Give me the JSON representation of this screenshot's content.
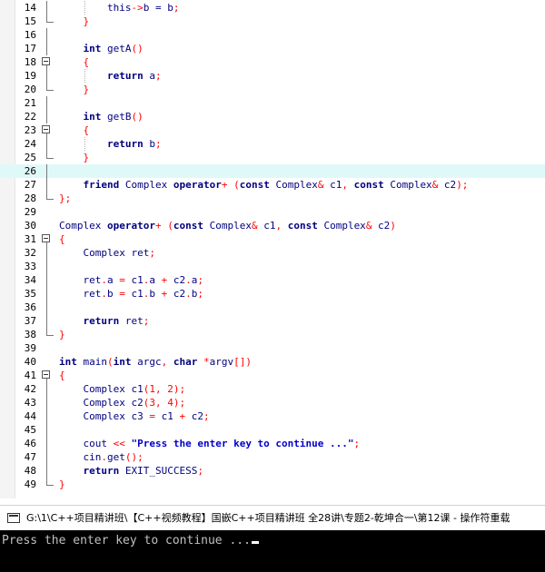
{
  "editor": {
    "lines": [
      {
        "n": "14",
        "parts": [
          [
            "        ",
            ""
          ],
          [
            "this",
            ""
          ],
          [
            "->",
            "op"
          ],
          [
            "b = b",
            ""
          ],
          [
            ";",
            "op"
          ]
        ]
      },
      {
        "n": "15",
        "parts": [
          [
            "    ",
            ""
          ],
          [
            "}",
            "op"
          ]
        ]
      },
      {
        "n": "16",
        "parts": []
      },
      {
        "n": "17",
        "parts": [
          [
            "    ",
            ""
          ],
          [
            "int",
            "kw"
          ],
          [
            " getA",
            ""
          ],
          [
            "()",
            "op"
          ]
        ]
      },
      {
        "n": "18",
        "parts": [
          [
            "    ",
            ""
          ],
          [
            "{",
            "op"
          ]
        ]
      },
      {
        "n": "19",
        "parts": [
          [
            "        ",
            ""
          ],
          [
            "return",
            "kw"
          ],
          [
            " a",
            ""
          ],
          [
            ";",
            "op"
          ]
        ]
      },
      {
        "n": "20",
        "parts": [
          [
            "    ",
            ""
          ],
          [
            "}",
            "op"
          ]
        ]
      },
      {
        "n": "21",
        "parts": []
      },
      {
        "n": "22",
        "parts": [
          [
            "    ",
            ""
          ],
          [
            "int",
            "kw"
          ],
          [
            " getB",
            ""
          ],
          [
            "()",
            "op"
          ]
        ]
      },
      {
        "n": "23",
        "parts": [
          [
            "    ",
            ""
          ],
          [
            "{",
            "op"
          ]
        ]
      },
      {
        "n": "24",
        "parts": [
          [
            "        ",
            ""
          ],
          [
            "return",
            "kw"
          ],
          [
            " b",
            ""
          ],
          [
            ";",
            "op"
          ]
        ]
      },
      {
        "n": "25",
        "parts": [
          [
            "    ",
            ""
          ],
          [
            "}",
            "op"
          ]
        ]
      },
      {
        "n": "26",
        "parts": []
      },
      {
        "n": "27",
        "parts": [
          [
            "    ",
            ""
          ],
          [
            "friend",
            "kw"
          ],
          [
            " Complex ",
            ""
          ],
          [
            "operator",
            "kw"
          ],
          [
            "+",
            "op"
          ],
          [
            " ",
            ""
          ],
          [
            "(",
            "op"
          ],
          [
            "const",
            "kw"
          ],
          [
            " Complex",
            ""
          ],
          [
            "&",
            "op"
          ],
          [
            " c1",
            ""
          ],
          [
            ",",
            "op"
          ],
          [
            " ",
            ""
          ],
          [
            "const",
            "kw"
          ],
          [
            " Complex",
            ""
          ],
          [
            "&",
            "op"
          ],
          [
            " c2",
            ""
          ],
          [
            ");",
            "op"
          ]
        ]
      },
      {
        "n": "28",
        "parts": [
          [
            "};",
            "op"
          ]
        ]
      },
      {
        "n": "29",
        "parts": []
      },
      {
        "n": "30",
        "parts": [
          [
            "Complex ",
            ""
          ],
          [
            "operator",
            "kw"
          ],
          [
            "+",
            "op"
          ],
          [
            " ",
            ""
          ],
          [
            "(",
            "op"
          ],
          [
            "const",
            "kw"
          ],
          [
            " Complex",
            ""
          ],
          [
            "&",
            "op"
          ],
          [
            " c1",
            ""
          ],
          [
            ",",
            "op"
          ],
          [
            " ",
            ""
          ],
          [
            "const",
            "kw"
          ],
          [
            " Complex",
            ""
          ],
          [
            "&",
            "op"
          ],
          [
            " c2",
            ""
          ],
          [
            ")",
            "op"
          ]
        ]
      },
      {
        "n": "31",
        "parts": [
          [
            "{",
            "op"
          ]
        ]
      },
      {
        "n": "32",
        "parts": [
          [
            "    Complex ret",
            ""
          ],
          [
            ";",
            "op"
          ]
        ]
      },
      {
        "n": "33",
        "parts": []
      },
      {
        "n": "34",
        "parts": [
          [
            "    ret",
            ""
          ],
          [
            ".",
            "op"
          ],
          [
            "a ",
            ""
          ],
          [
            "=",
            "op"
          ],
          [
            " c1",
            ""
          ],
          [
            ".",
            "op"
          ],
          [
            "a ",
            ""
          ],
          [
            "+",
            "op"
          ],
          [
            " c2",
            ""
          ],
          [
            ".",
            "op"
          ],
          [
            "a",
            ""
          ],
          [
            ";",
            "op"
          ]
        ]
      },
      {
        "n": "35",
        "parts": [
          [
            "    ret",
            ""
          ],
          [
            ".",
            "op"
          ],
          [
            "b ",
            ""
          ],
          [
            "=",
            "op"
          ],
          [
            " c1",
            ""
          ],
          [
            ".",
            "op"
          ],
          [
            "b ",
            ""
          ],
          [
            "+",
            "op"
          ],
          [
            " c2",
            ""
          ],
          [
            ".",
            "op"
          ],
          [
            "b",
            ""
          ],
          [
            ";",
            "op"
          ]
        ]
      },
      {
        "n": "36",
        "parts": []
      },
      {
        "n": "37",
        "parts": [
          [
            "    ",
            ""
          ],
          [
            "return",
            "kw"
          ],
          [
            " ret",
            ""
          ],
          [
            ";",
            "op"
          ]
        ]
      },
      {
        "n": "38",
        "parts": [
          [
            "}",
            "op"
          ]
        ]
      },
      {
        "n": "39",
        "parts": []
      },
      {
        "n": "40",
        "parts": [
          [
            "int",
            "kw"
          ],
          [
            " main",
            ""
          ],
          [
            "(",
            "op"
          ],
          [
            "int",
            "kw"
          ],
          [
            " argc",
            ""
          ],
          [
            ",",
            "op"
          ],
          [
            " ",
            ""
          ],
          [
            "char",
            "kw"
          ],
          [
            " ",
            ""
          ],
          [
            "*",
            "op"
          ],
          [
            "argv",
            ""
          ],
          [
            "[])",
            "op"
          ]
        ]
      },
      {
        "n": "41",
        "parts": [
          [
            "{",
            "op"
          ]
        ]
      },
      {
        "n": "42",
        "parts": [
          [
            "    Complex c1",
            ""
          ],
          [
            "(",
            "op"
          ],
          [
            "1",
            "num"
          ],
          [
            ", ",
            "op"
          ],
          [
            "2",
            "num"
          ],
          [
            ");",
            "op"
          ]
        ]
      },
      {
        "n": "43",
        "parts": [
          [
            "    Complex c2",
            ""
          ],
          [
            "(",
            "op"
          ],
          [
            "3",
            "num"
          ],
          [
            ", ",
            "op"
          ],
          [
            "4",
            "num"
          ],
          [
            ");",
            "op"
          ]
        ]
      },
      {
        "n": "44",
        "parts": [
          [
            "    Complex c3 ",
            ""
          ],
          [
            "=",
            "op"
          ],
          [
            " c1 ",
            ""
          ],
          [
            "+",
            "op"
          ],
          [
            " c2",
            ""
          ],
          [
            ";",
            "op"
          ]
        ]
      },
      {
        "n": "45",
        "parts": []
      },
      {
        "n": "46",
        "parts": [
          [
            "    cout ",
            ""
          ],
          [
            "<<",
            "op"
          ],
          [
            " ",
            ""
          ],
          [
            "\"Press the enter key to continue ...\"",
            "str"
          ],
          [
            ";",
            "op"
          ]
        ]
      },
      {
        "n": "47",
        "parts": [
          [
            "    cin",
            ""
          ],
          [
            ".",
            "op"
          ],
          [
            "get",
            ""
          ],
          [
            "();",
            "op"
          ]
        ]
      },
      {
        "n": "48",
        "parts": [
          [
            "    ",
            ""
          ],
          [
            "return",
            "kw"
          ],
          [
            " EXIT_SUCCESS",
            ""
          ],
          [
            ";",
            "op"
          ]
        ]
      },
      {
        "n": "49",
        "parts": [
          [
            "}",
            "op"
          ]
        ]
      }
    ],
    "highlight_line": "26",
    "colors": {
      "keyword": "#000080",
      "operator": "#ff0000",
      "string": "#0000cc",
      "highlight": "#dff9f9"
    }
  },
  "console": {
    "icon": "console-window-icon",
    "title": "G:\\1\\C++项目精讲班\\【C++视频教程】国嵌C++项目精讲班 全28讲\\专题2-乾坤合一\\第12课 - 操作符重载",
    "output": "Press the enter key to continue ..."
  }
}
